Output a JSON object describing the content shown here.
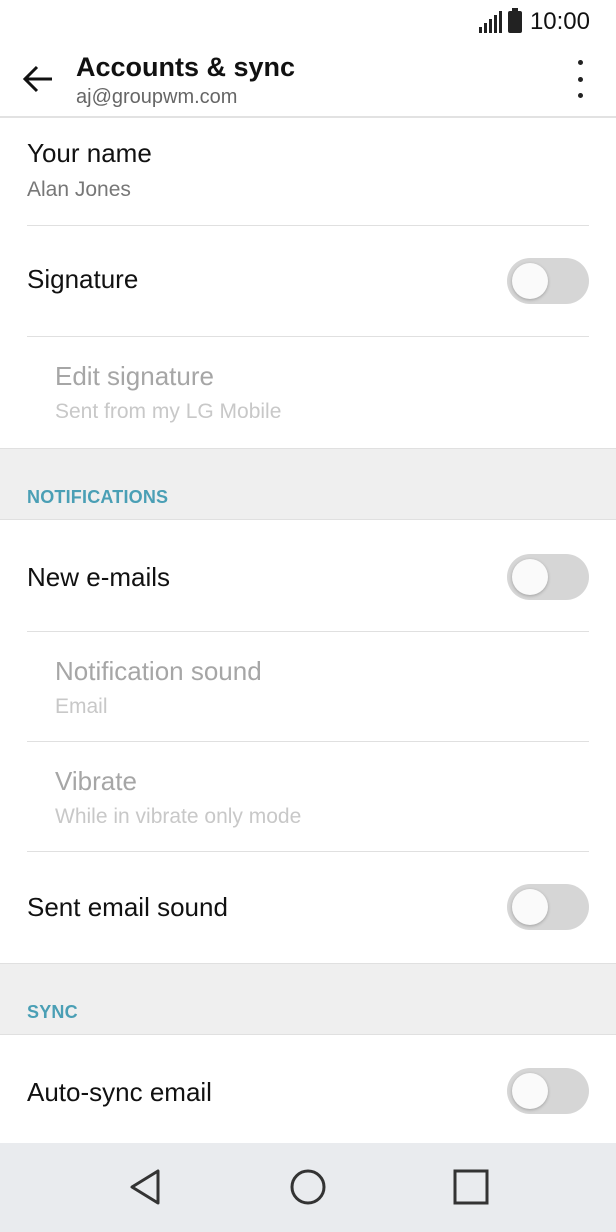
{
  "status": {
    "time": "10:00"
  },
  "header": {
    "title": "Accounts & sync",
    "subtitle": "aj@groupwm.com"
  },
  "settings": {
    "your_name": {
      "label": "Your name",
      "value": "Alan Jones"
    },
    "signature": {
      "label": "Signature",
      "enabled": false
    },
    "edit_signature": {
      "label": "Edit signature",
      "value": "Sent from my LG Mobile"
    },
    "notifications_header": "NOTIFICATIONS",
    "new_emails": {
      "label": "New e-mails",
      "enabled": false
    },
    "notification_sound": {
      "label": "Notification sound",
      "value": "Email"
    },
    "vibrate": {
      "label": "Vibrate",
      "value": "While in vibrate only mode"
    },
    "sent_email_sound": {
      "label": "Sent email sound",
      "enabled": false
    },
    "sync_header": "SYNC",
    "auto_sync": {
      "label": "Auto-sync email",
      "enabled": false
    }
  },
  "colors": {
    "section_header": "#4a9fb5",
    "toggle_off": "#d6d6d6",
    "navbar": "#e9ebee"
  },
  "icons": {
    "back": "arrow-left",
    "menu": "more-vertical",
    "nav_back": "triangle-left",
    "nav_home": "circle",
    "nav_recents": "square"
  }
}
